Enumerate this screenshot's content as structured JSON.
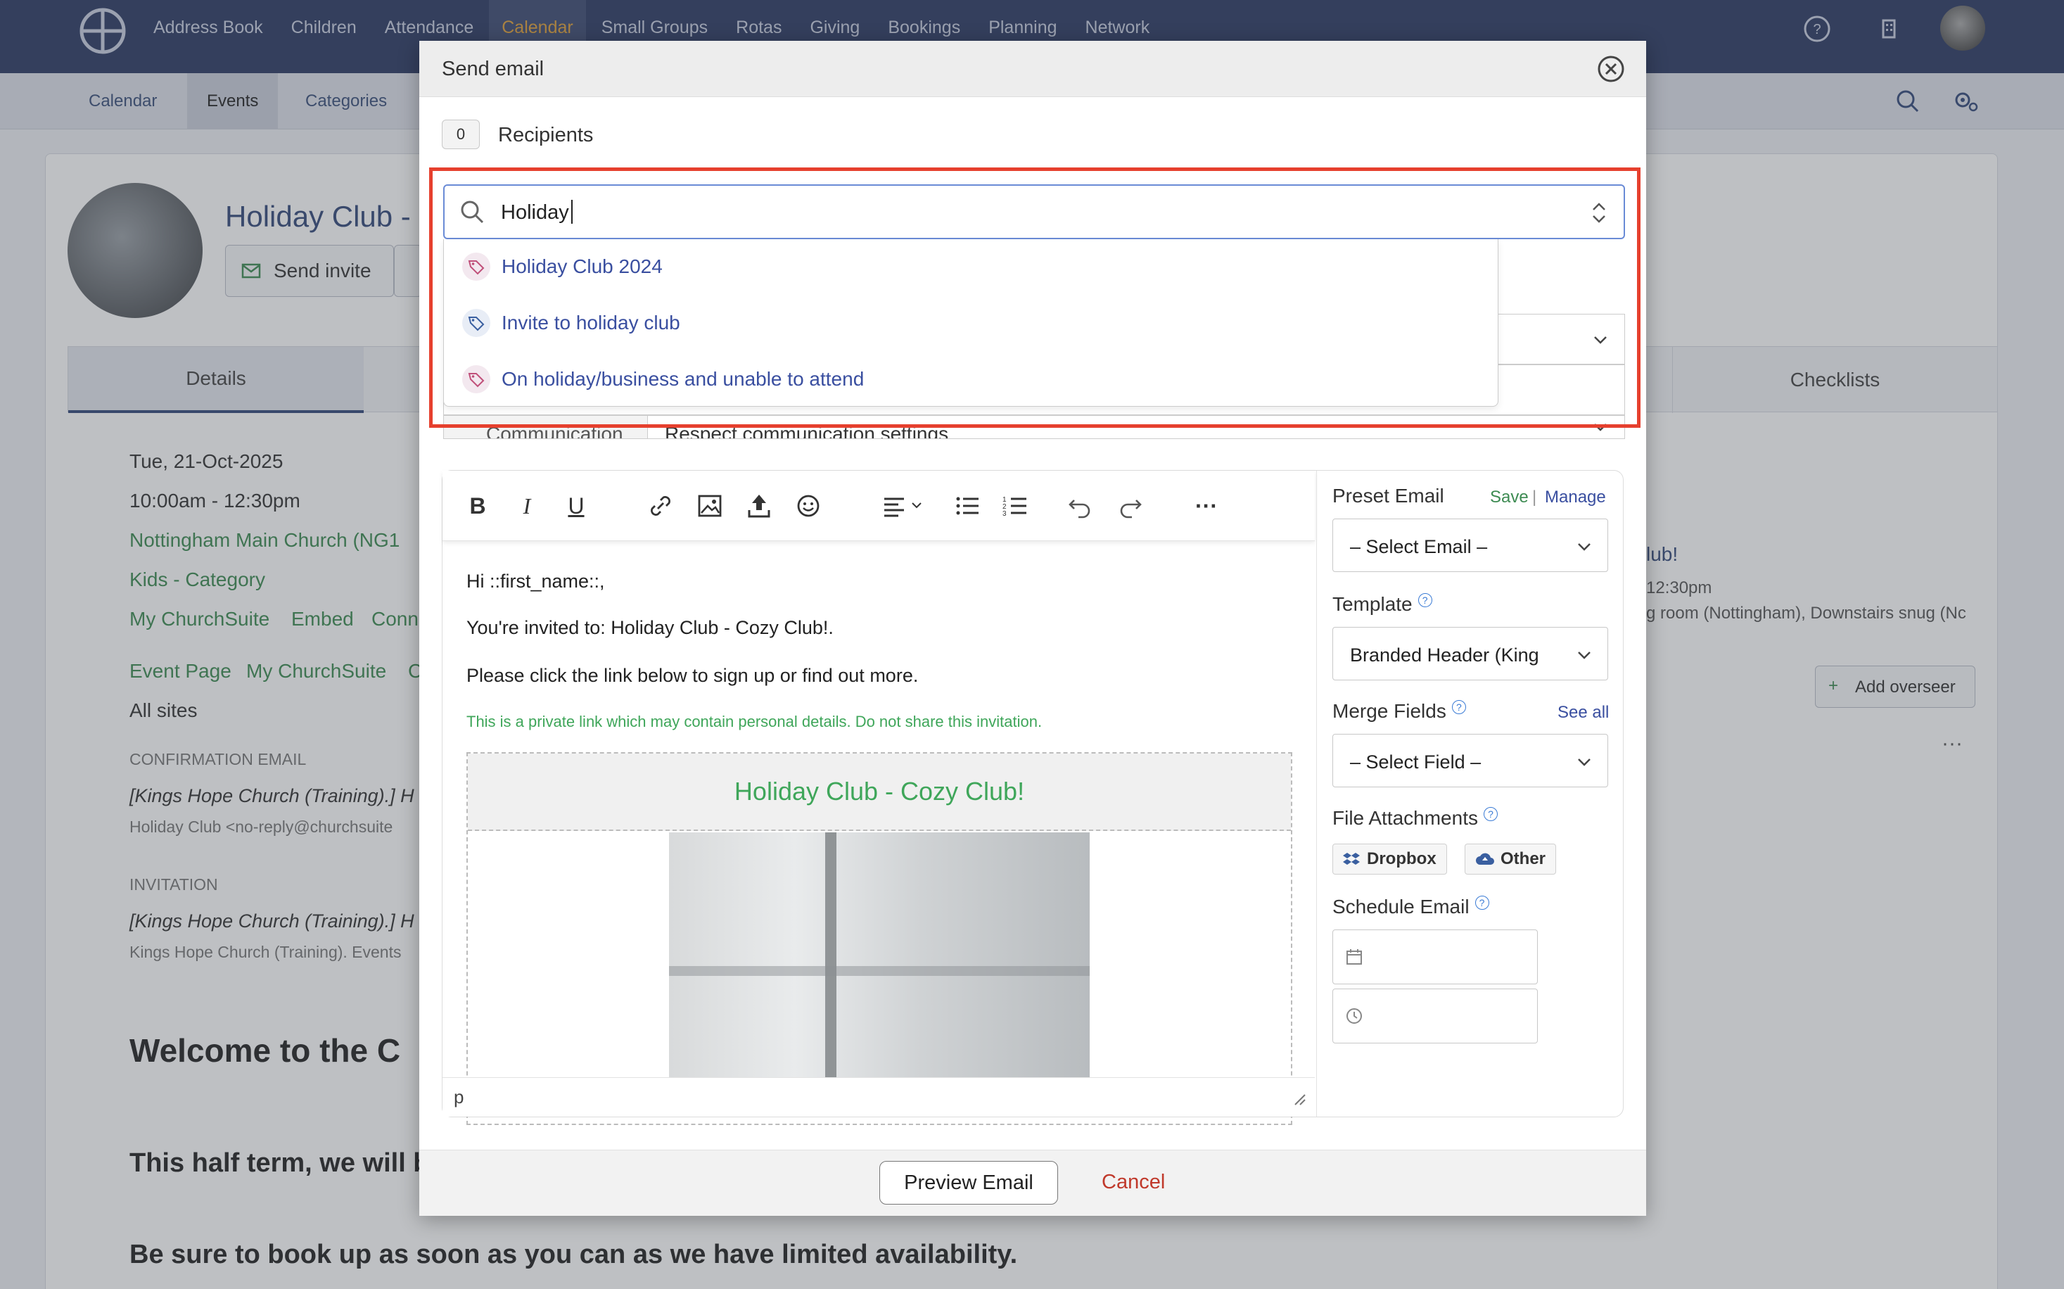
{
  "topnav": {
    "items": [
      "Address Book",
      "Children",
      "Attendance",
      "Calendar",
      "Small Groups",
      "Rotas",
      "Giving",
      "Bookings",
      "Planning",
      "Network"
    ],
    "active": "Calendar"
  },
  "subnav": {
    "items": [
      "Calendar",
      "Events",
      "Categories"
    ],
    "active": "Events"
  },
  "event": {
    "title": "Holiday Club -",
    "send_invite": "Send invite",
    "tabs": [
      "Details",
      "Checklists"
    ],
    "date": "Tue, 21-Oct-2025",
    "time": "10:00am - 12:30pm",
    "location": "Nottingham Main Church (NG1",
    "category": "Kids - Category",
    "links1": [
      "My ChurchSuite",
      "Embed",
      "Conn"
    ],
    "links2": [
      "Event Page",
      "My ChurchSuite",
      "C"
    ],
    "sites": "All sites",
    "confirmation_heading": "CONFIRMATION EMAIL",
    "confirmation_subject": "[Kings Hope Church (Training).] H",
    "confirmation_from": "Holiday Club  <no-reply@churchsuite",
    "invitation_heading": "INVITATION",
    "invitation_subject": "[Kings Hope Church (Training).] H",
    "invitation_from": "Kings Hope Church (Training). Events",
    "welcome": "Welcome to the C",
    "halfterm": "This half term, we will b",
    "booking": "Be sure to book up as soon as you can as we have limited availability.",
    "right_title": "lub!",
    "right_time": "12:30pm",
    "right_rooms": "g room (Nottingham), Downstairs snug (Nc",
    "add_overseer": "Add overseer"
  },
  "modal": {
    "title": "Send email",
    "recipients_count": "0",
    "recipients_label": "Recipients",
    "search_value": "Holiday",
    "suggestions": [
      "Holiday Club 2024",
      "Invite to holiday club",
      "On holiday/business and unable to attend"
    ],
    "communication_label": "Communication",
    "communication_value": "Respect communication settings",
    "body": {
      "line1": "Hi ::first_name::,",
      "line2": "You're invited to: Holiday Club - Cozy Club!.",
      "line3": "Please click the link below to sign up or find out more.",
      "private": "This is a private link which may contain personal details. Do not share this invitation.",
      "header": "Holiday Club - Cozy Club!"
    },
    "status_path": "p",
    "preset_email_label": "Preset Email",
    "save": "Save",
    "manage": "Manage",
    "select_email": "– Select Email –",
    "template_label": "Template",
    "template_value": "Branded Header (King",
    "merge_fields_label": "Merge Fields",
    "see_all": "See all",
    "select_field": "– Select Field –",
    "attachments_label": "File Attachments",
    "dropbox": "Dropbox",
    "other": "Other",
    "schedule_label": "Schedule Email",
    "preview": "Preview Email",
    "cancel": "Cancel"
  },
  "colors": {
    "nav_bg": "#2c3a63",
    "accent": "#e0a13a",
    "highlight": "#e6402e",
    "link": "#3a4fa0",
    "green": "#3fa65a"
  }
}
